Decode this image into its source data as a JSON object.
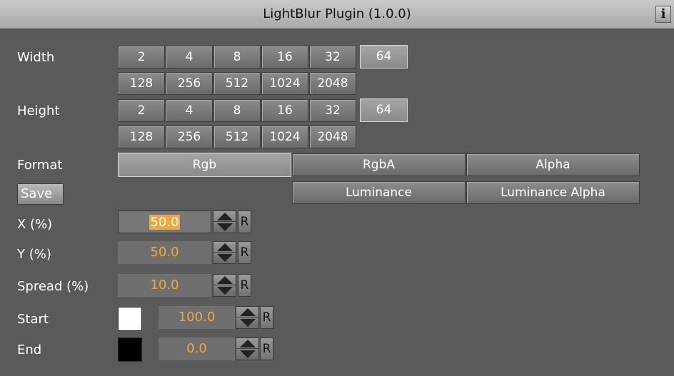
{
  "header": {
    "title": "LightBlur Plugin (1.0.0)",
    "info_label": "i"
  },
  "width": {
    "label": "Width",
    "options_row1": [
      "2",
      "4",
      "8",
      "16",
      "32",
      "64"
    ],
    "options_row2": [
      "128",
      "256",
      "512",
      "1024",
      "2048"
    ],
    "selected": "64"
  },
  "height": {
    "label": "Height",
    "options_row1": [
      "2",
      "4",
      "8",
      "16",
      "32",
      "64"
    ],
    "options_row2": [
      "128",
      "256",
      "512",
      "1024",
      "2048"
    ],
    "selected": "64"
  },
  "format": {
    "label": "Format",
    "options": [
      "Rgb",
      "RgbA",
      "Alpha",
      "Luminance",
      "Luminance Alpha"
    ],
    "selected": "Rgb"
  },
  "save_label": "Save",
  "x": {
    "label": "X (%)",
    "value": "50.0",
    "reset": "R"
  },
  "y": {
    "label": "Y (%)",
    "value": "50.0",
    "reset": "R"
  },
  "spread": {
    "label": "Spread (%)",
    "value": "10.0",
    "reset": "R"
  },
  "start": {
    "label": "Start",
    "value": "100.0",
    "reset": "R",
    "color": "#ffffff"
  },
  "end": {
    "label": "End",
    "value": "0.0",
    "reset": "R",
    "color": "#000000"
  },
  "colors": {
    "accent_value": "#f3a73b",
    "panel": "#5a5a5a"
  }
}
